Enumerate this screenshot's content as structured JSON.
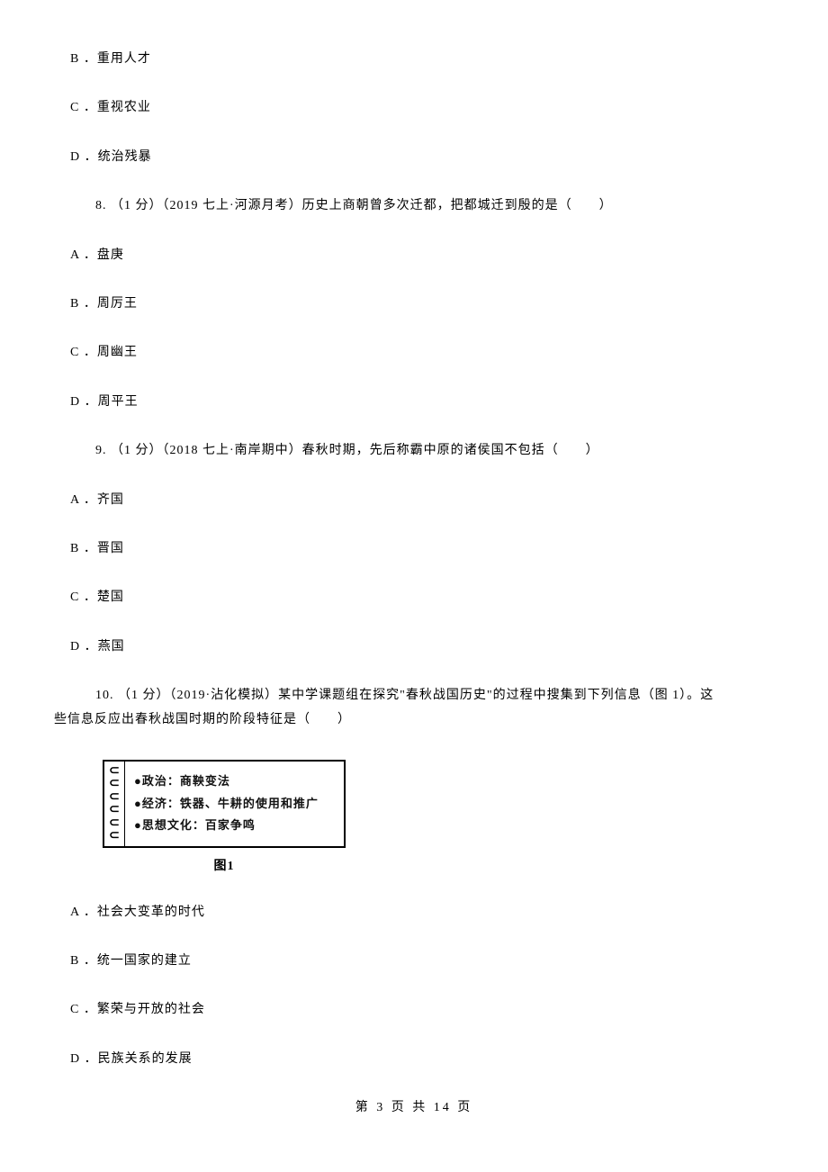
{
  "q7": {
    "options": {
      "B": "B ．重用人才",
      "C": "C ．重视农业",
      "D": "D ．统治残暴"
    }
  },
  "q8": {
    "text": "8. （1 分）（2019 七上·河源月考）历史上商朝曾多次迁都，把都城迁到殷的是（　　）",
    "options": {
      "A": "A ．盘庚",
      "B": "B ．周厉王",
      "C": "C ．周幽王",
      "D": "D ．周平王"
    }
  },
  "q9": {
    "text": "9. （1 分）（2018 七上·南岸期中）春秋时期，先后称霸中原的诸侯国不包括（　　）",
    "options": {
      "A": "A ．齐国",
      "B": "B ．晋国",
      "C": "C ．楚国",
      "D": "D ．燕国"
    }
  },
  "q10": {
    "text_line1": "10. （1 分）（2019·沾化模拟）某中学课题组在探究\"春秋战国历史\"的过程中搜集到下列信息（图 1）。这",
    "text_line2": "些信息反应出春秋战国时期的阶段特征是（　　）",
    "figure": {
      "item1": "●政治：商鞅变法",
      "item2": "●经济：铁器、牛耕的使用和推广",
      "item3": "●思想文化：百家争鸣",
      "caption": "图1"
    },
    "options": {
      "A": "A ．社会大变革的时代",
      "B": "B ．统一国家的建立",
      "C": "C ．繁荣与开放的社会",
      "D": "D ．民族关系的发展"
    }
  },
  "footer": "第 3 页 共 14 页"
}
